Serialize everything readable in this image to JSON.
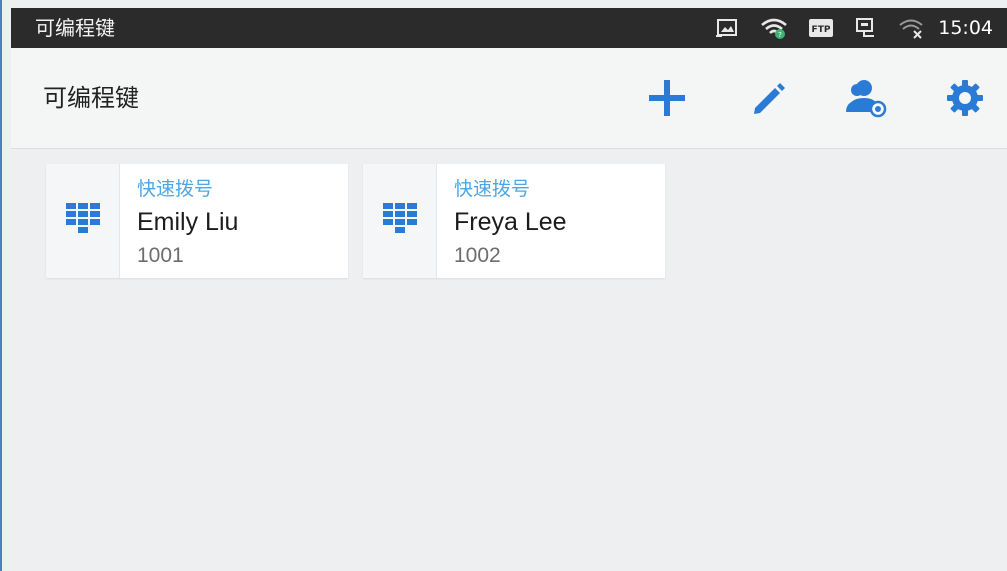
{
  "status_bar": {
    "title": "可编程键",
    "time": "15:04",
    "icons": [
      "screenshot-icon",
      "wifi-icon",
      "ftp-icon",
      "network-icon",
      "wifi-off-icon"
    ],
    "ftp_label": "FTP"
  },
  "header": {
    "title": "可编程键",
    "actions": [
      "add-icon",
      "edit-icon",
      "contacts-view-icon",
      "settings-icon"
    ]
  },
  "colors": {
    "accent": "#2a7bd6",
    "label_blue": "#4ba7e6",
    "status_bar_bg": "#2b2b2b",
    "background": "#edeff1"
  },
  "cards": [
    {
      "type": "快速拨号",
      "name": "Emily Liu",
      "number": "1001",
      "icon": "keypad-icon"
    },
    {
      "type": "快速拨号",
      "name": "Freya Lee",
      "number": "1002",
      "icon": "keypad-icon"
    }
  ]
}
